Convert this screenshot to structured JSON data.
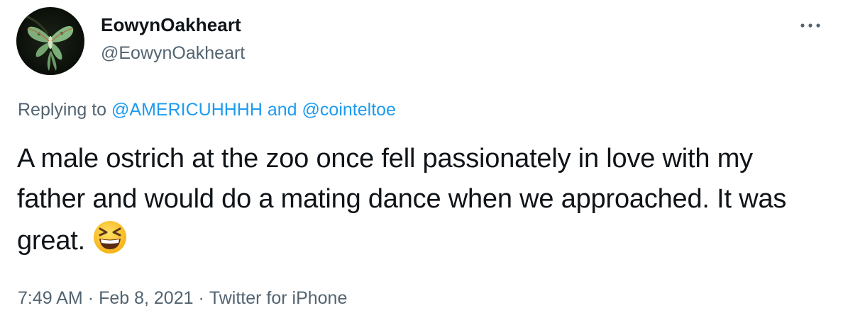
{
  "author": {
    "display_name": "EowynOakheart",
    "handle": "@EowynOakheart",
    "avatar_icon": "luna-moth-avatar"
  },
  "more_icon": "more-options-icon",
  "reply": {
    "prefix": "Replying to",
    "user1": "@AMERICUHHHH",
    "conjunction": "and",
    "user2": "@cointeltoe"
  },
  "tweet": {
    "text": "A male ostrich at the zoo once fell passionately in love with my father and would do a mating dance when we approached. It was great.",
    "emoji": "grinning-squinting-face-emoji"
  },
  "meta": {
    "time": "7:49 AM",
    "separator": "·",
    "date": "Feb 8, 2021",
    "source": "Twitter for iPhone"
  },
  "colors": {
    "text": "#0f1419",
    "secondary": "#536471",
    "link": "#1d9bf0"
  }
}
